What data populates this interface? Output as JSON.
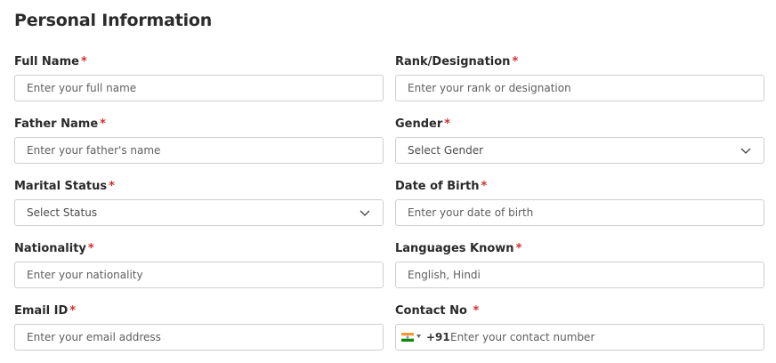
{
  "title": "Personal Information",
  "required_mark": "*",
  "fields": {
    "full_name": {
      "label": "Full Name",
      "placeholder": "Enter your full name"
    },
    "rank": {
      "label": "Rank/Designation",
      "placeholder": "Enter your rank or designation"
    },
    "father_name": {
      "label": "Father Name",
      "placeholder": "Enter your father's name"
    },
    "gender": {
      "label": "Gender",
      "selected": "Select Gender"
    },
    "marital_status": {
      "label": "Marital Status",
      "selected": "Select Status"
    },
    "dob": {
      "label": "Date of Birth",
      "placeholder": "Enter your date of birth"
    },
    "nationality": {
      "label": "Nationality",
      "placeholder": "Enter your nationality"
    },
    "languages": {
      "label": "Languages Known",
      "placeholder": "English, Hindi"
    },
    "email": {
      "label": "Email ID",
      "placeholder": "Enter your email address"
    },
    "contact": {
      "label": "Contact No",
      "country_code": "+91",
      "country_flag": "india-flag-icon",
      "placeholder": "Enter your contact number"
    }
  },
  "colors": {
    "required": "#d32f2f",
    "border": "#cfcfcf"
  }
}
